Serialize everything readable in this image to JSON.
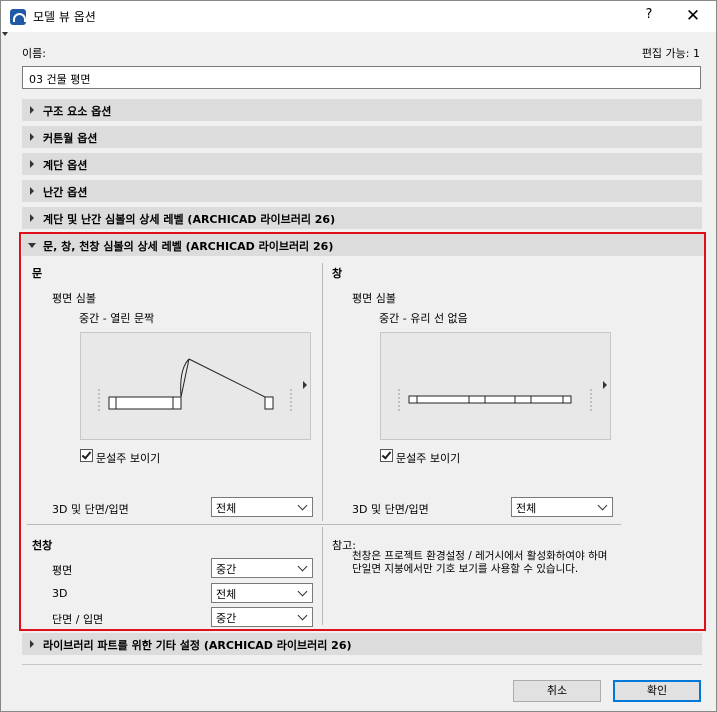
{
  "window": {
    "title": "모델 뷰 옵션",
    "help_label": "?",
    "close_label": "✕"
  },
  "name": {
    "label": "이름:",
    "value": "03 건물 평면",
    "editors": "편집 가능: 1"
  },
  "sections": [
    {
      "label": "구조 요소 옵션"
    },
    {
      "label": "커튼월 옵션"
    },
    {
      "label": "계단 옵션"
    },
    {
      "label": "난간 옵션"
    },
    {
      "label": "계단 및 난간 심볼의 상세 레벨 (ARCHICAD 라이브러리 26)"
    },
    {
      "label": "문, 창, 천창 심볼의 상세 레벨 (ARCHICAD 라이브러리 26)"
    },
    {
      "label": "라이브러리 파트를 위한 기타 설정 (ARCHICAD 라이브러리 26)"
    }
  ],
  "door": {
    "heading": "문",
    "plan_symbol_label": "평면 심볼",
    "plan_symbol_value": "중간 - 열린 문짝",
    "show_jamb_label": "문설주 보이기",
    "show_jamb_checked": true,
    "section_label": "3D 및 단면/입면",
    "section_value": "전체"
  },
  "window_opt": {
    "heading": "창",
    "plan_symbol_label": "평면 심볼",
    "plan_symbol_value": "중간 - 유리 선 없음",
    "show_jamb_label": "문설주 보이기",
    "show_jamb_checked": true,
    "section_label": "3D 및 단면/입면",
    "section_value": "전체"
  },
  "skylight": {
    "heading": "천창",
    "plan_label": "평면",
    "plan_value": "중간",
    "threed_label": "3D",
    "threed_value": "전체",
    "section_label": "단면 / 입면",
    "section_value": "중간"
  },
  "note": {
    "heading": "참고:",
    "text": "천창은 프로젝트 환경설정 / 레거시에서 활성화하여야 하며 단일면 지붕에서만 기호 보기를 사용할 수 있습니다."
  },
  "buttons": {
    "cancel": "취소",
    "ok": "확인"
  },
  "colors": {
    "highlight_border": "#e0101a",
    "primary_button_border": "#0078d7"
  }
}
